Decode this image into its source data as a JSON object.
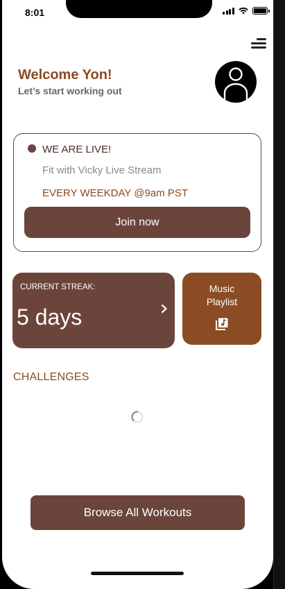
{
  "status_bar": {
    "time": "8:01"
  },
  "header": {
    "welcome": "Welcome Yon!",
    "subtitle": "Let’s start working out"
  },
  "live": {
    "title": "WE ARE LIVE!",
    "stream_name": "Fit with Vicky Live Stream",
    "schedule": "EVERY WEEKDAY @9am PST",
    "join_label": "Join now"
  },
  "streak": {
    "label": "CURRENT STREAK:",
    "value": "5 days"
  },
  "music": {
    "label_line1": "Music",
    "label_line2": "Playlist"
  },
  "challenges": {
    "title": "CHALLENGES"
  },
  "browse": {
    "label": "Browse All Workouts"
  },
  "colors": {
    "primary": "#6b453c",
    "accent": "#8b4c24",
    "heading": "#8b4a22"
  }
}
